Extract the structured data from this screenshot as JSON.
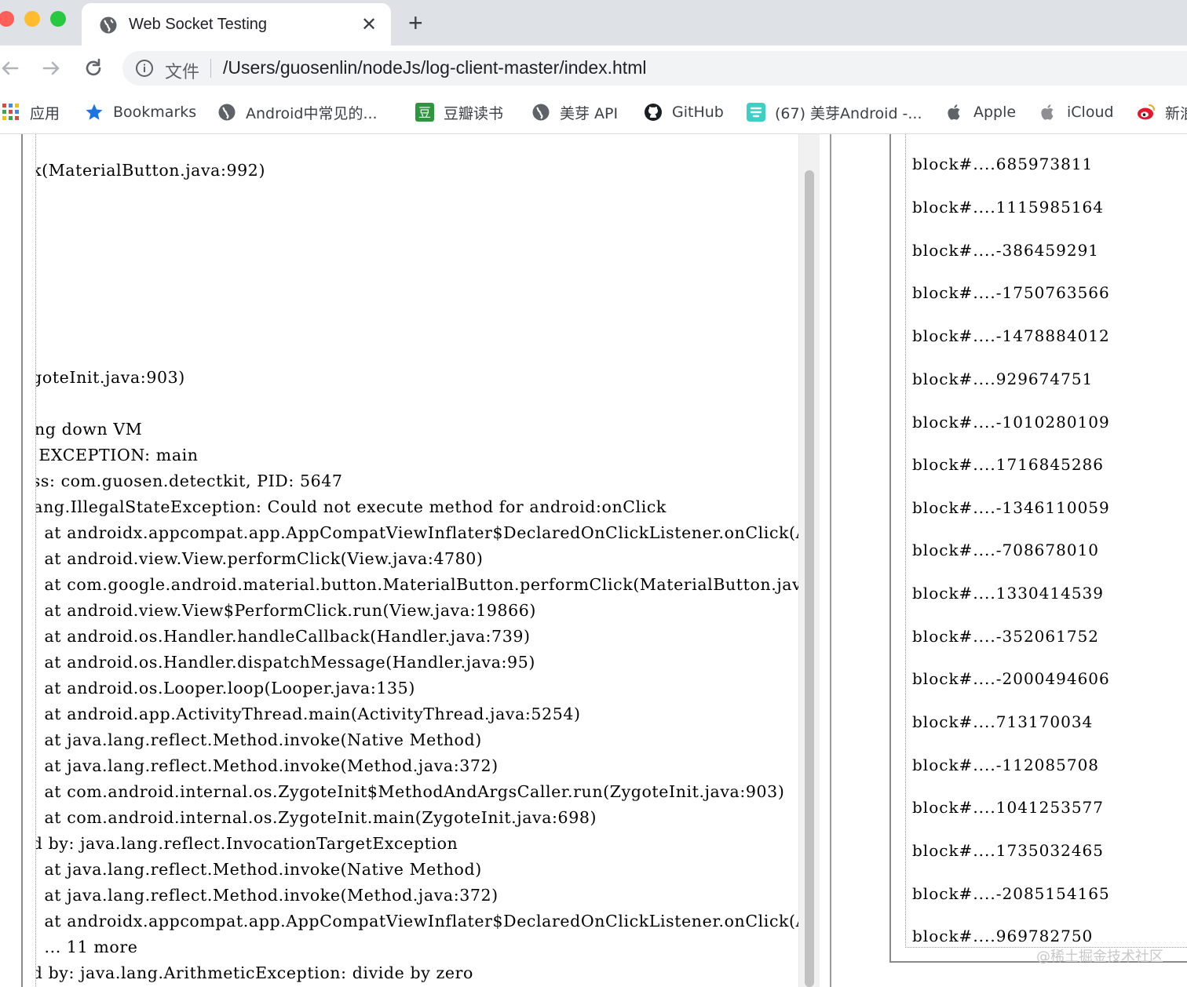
{
  "tab": {
    "title": "Web Socket Testing",
    "close_glyph": "✕",
    "new_tab_glyph": "+"
  },
  "omnibox": {
    "scheme_label": "文件",
    "url": "/Users/guosenlin/nodeJs/log-client-master/index.html"
  },
  "bookmarks": [
    {
      "label": "应用",
      "icon": "apps-grid-icon"
    },
    {
      "label": "Bookmarks",
      "icon": "star-icon"
    },
    {
      "label": "Android中常见的...",
      "icon": "globe-icon"
    },
    {
      "label": "豆瓣读书",
      "icon": "douban-icon"
    },
    {
      "label": "美芽 API",
      "icon": "globe-icon"
    },
    {
      "label": "GitHub",
      "icon": "github-icon"
    },
    {
      "label": "(67) 美芽Android -...",
      "icon": "meiya-icon"
    },
    {
      "label": "Apple",
      "icon": "apple-icon"
    },
    {
      "label": "iCloud",
      "icon": "apple-icon"
    },
    {
      "label": "新浪",
      "icon": "weibo-icon"
    }
  ],
  "log": {
    "text": "ck(MaterialButton.java:992)\n\n\n\n\n\n\n\nygoteInit.java:903)\n\nting down VM\nL EXCEPTION: main\ness: com.guosen.detectkit, PID: 5647\n.lang.IllegalStateException: Could not execute method for android:onClick\n    at androidx.appcompat.app.AppCompatViewInflater$DeclaredOnClickListener.onClick(AppCompatViewInflater.java:390)\n    at android.view.View.performClick(View.java:4780)\n    at com.google.android.material.button.MaterialButton.performClick(MaterialButton.java:992)\n    at android.view.View$PerformClick.run(View.java:19866)\n    at android.os.Handler.handleCallback(Handler.java:739)\n    at android.os.Handler.dispatchMessage(Handler.java:95)\n    at android.os.Looper.loop(Looper.java:135)\n    at android.app.ActivityThread.main(ActivityThread.java:5254)\n    at java.lang.reflect.Method.invoke(Native Method)\n    at java.lang.reflect.Method.invoke(Method.java:372)\n    at com.android.internal.os.ZygoteInit$MethodAndArgsCaller.run(ZygoteInit.java:903)\n    at com.android.internal.os.ZygoteInit.main(ZygoteInit.java:698)\ned by: java.lang.reflect.InvocationTargetException\n    at java.lang.reflect.Method.invoke(Native Method)\n    at java.lang.reflect.Method.invoke(Method.java:372)\n    at androidx.appcompat.app.AppCompatViewInflater$DeclaredOnClickListener.onClick(AppCompatViewInflater.java:385)\n    ... 11 more\ned by: java.lang.ArithmeticException: divide by zero"
  },
  "blocks": [
    "block#....685973811",
    "block#....1115985164",
    "block#....-386459291",
    "block#....-1750763566",
    "block#....-1478884012",
    "block#....929674751",
    "block#....-1010280109",
    "block#....1716845286",
    "block#....-1346110059",
    "block#....-708678010",
    "block#....1330414539",
    "block#....-352061752",
    "block#....-2000494606",
    "block#....713170034",
    "block#....-112085708",
    "block#....1041253577",
    "block#....1735032465",
    "block#....-2085154165",
    "block#....969782750"
  ],
  "watermark": "@稀土掘金技术社区",
  "colors": {
    "tab_strip": "#dee1e6",
    "omnibox": "#f1f3f4",
    "scrollbar_thumb": "#c1c1c1"
  }
}
